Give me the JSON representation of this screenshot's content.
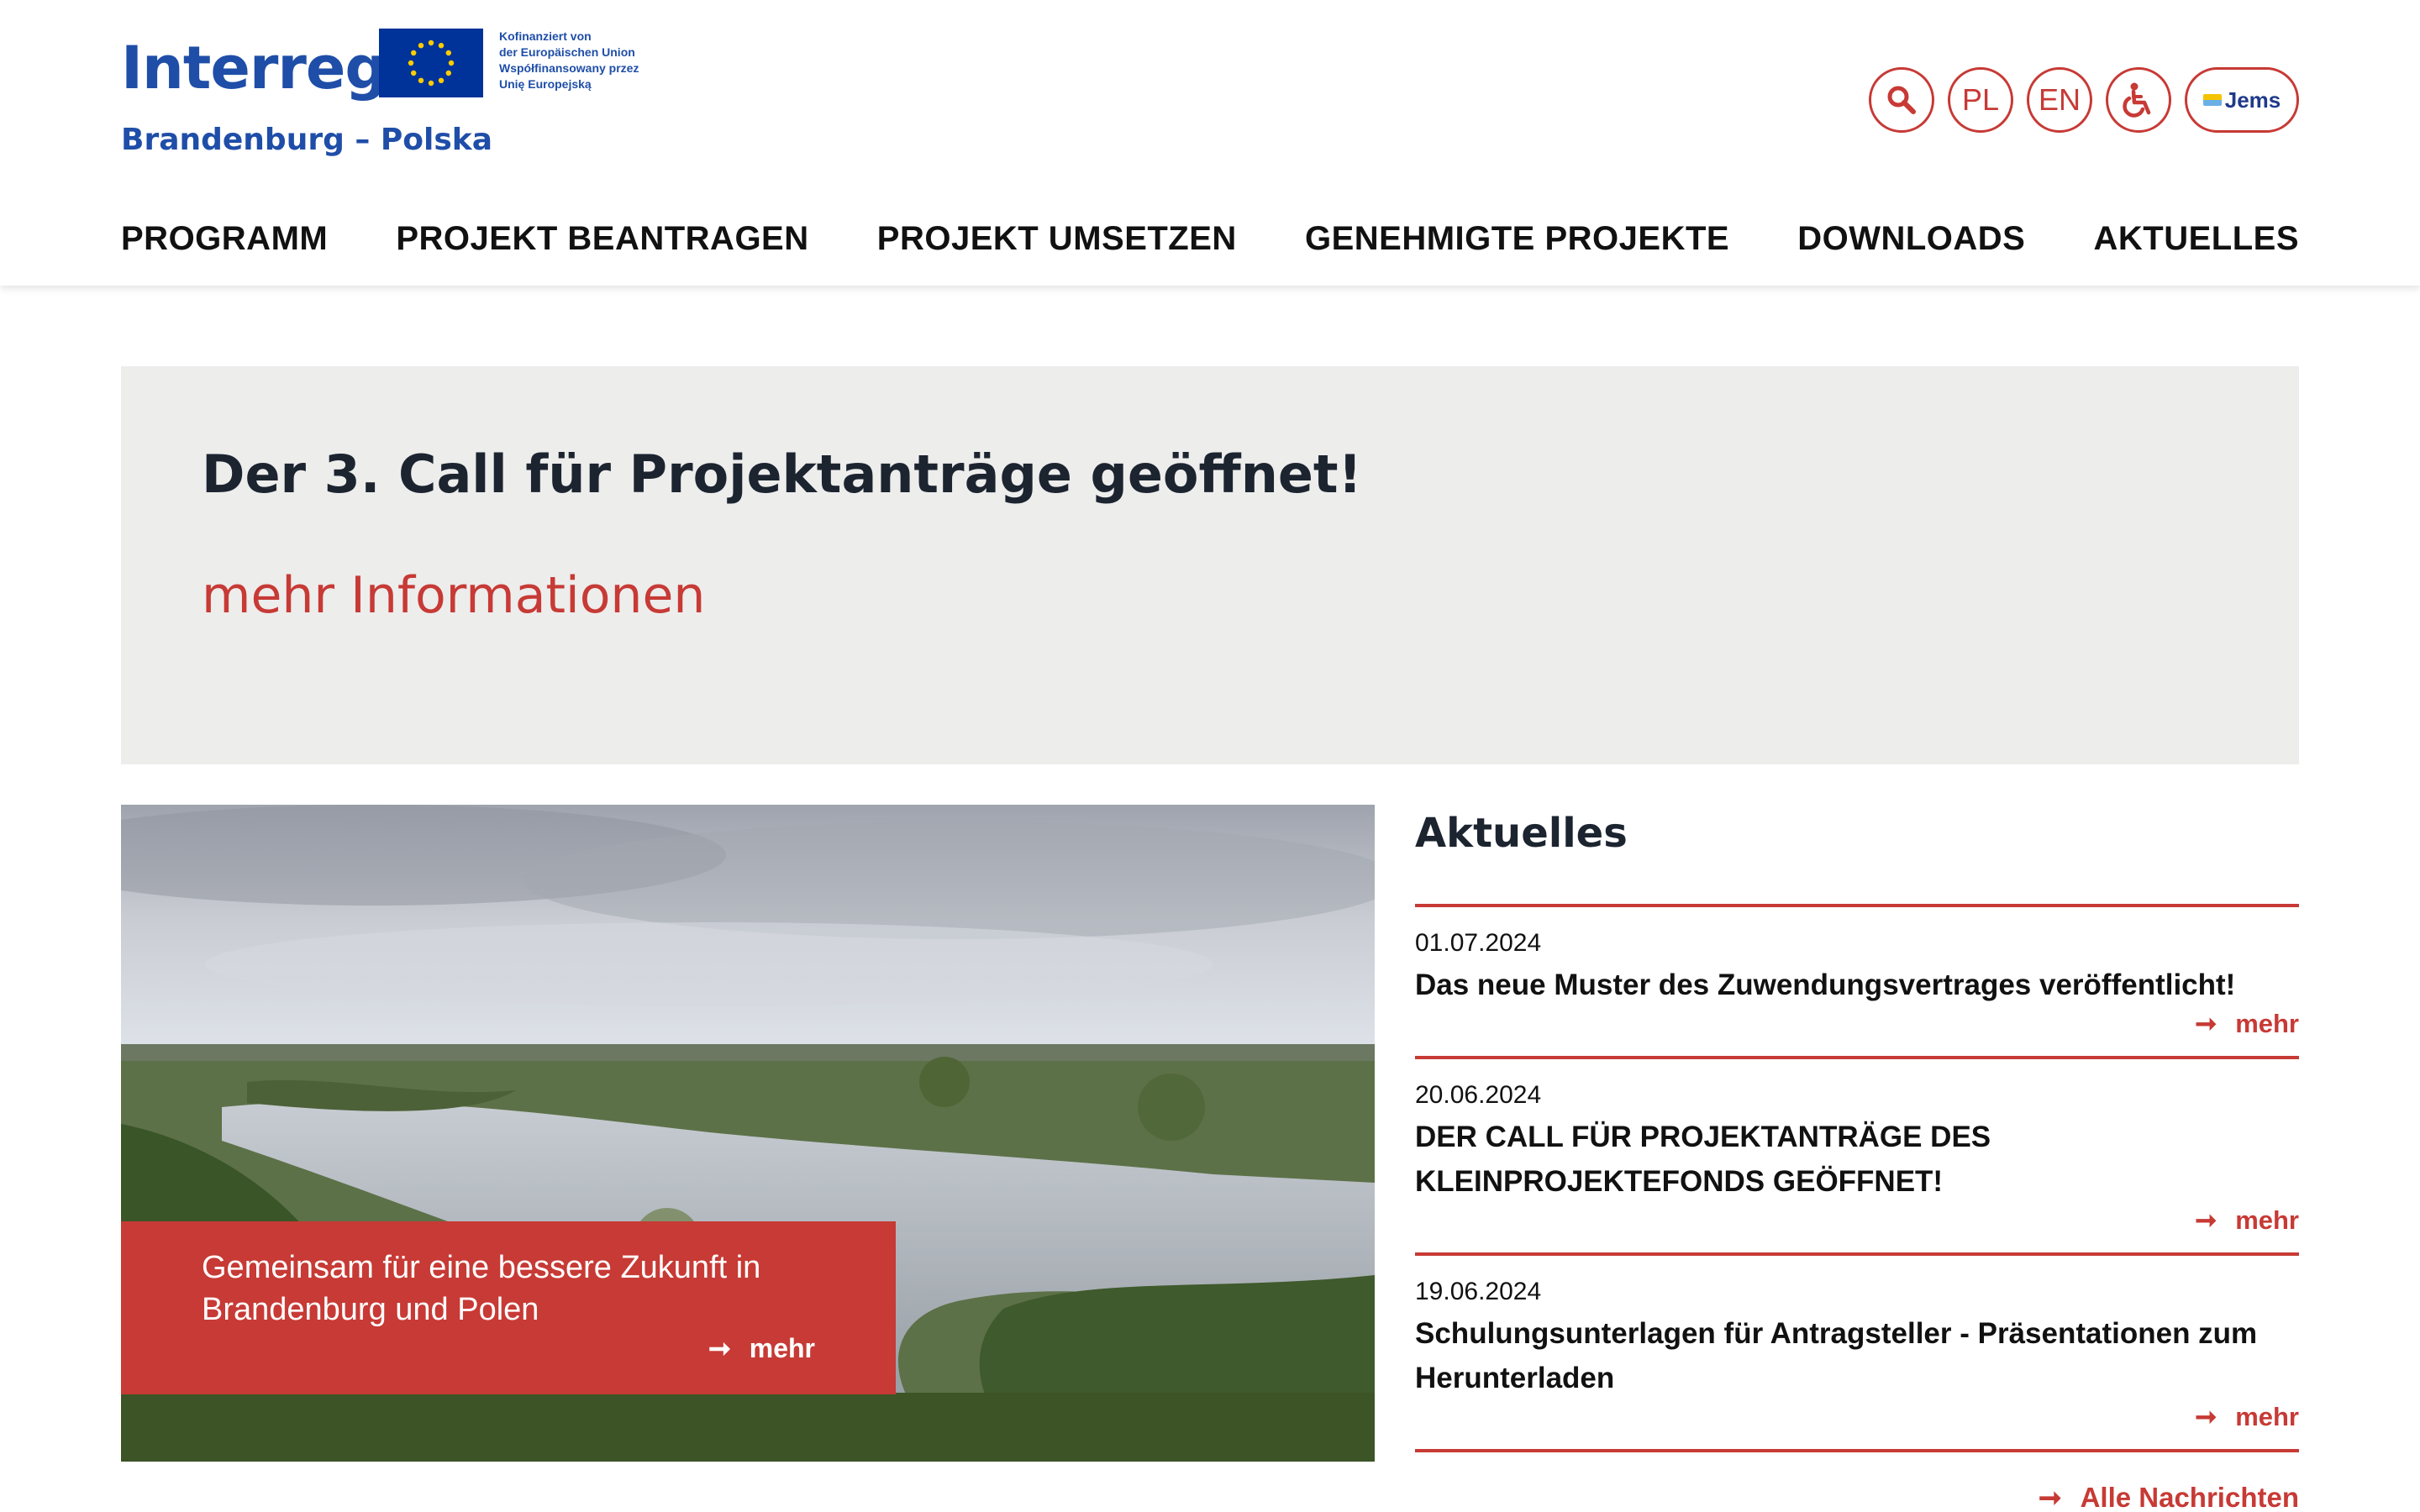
{
  "header": {
    "logo_word": "Interreg",
    "logo_region": "Brandenburg – Polska",
    "eu_lines": [
      "Kofinanziert von",
      "der Europäischen Union",
      "Współfinansowany przez",
      "Unię Europejską"
    ],
    "utility": {
      "search_icon": "search-icon",
      "lang_pl": "PL",
      "lang_en": "EN",
      "accessibility_icon": "wheelchair-icon",
      "jems_label": "Jems"
    }
  },
  "nav": [
    "PROGRAMM",
    "PROJEKT BEANTRAGEN",
    "PROJEKT UMSETZEN",
    "GENEHMIGTE PROJEKTE",
    "DOWNLOADS",
    "AKTUELLES"
  ],
  "banner": {
    "title": "Der 3. Call für Projektanträge geöffnet!",
    "link": "mehr Informationen"
  },
  "hero": {
    "text": "Gemeinsam für eine bessere Zukunft in Brandenburg und Polen",
    "more": "mehr"
  },
  "news": {
    "title": "Aktuelles",
    "items": [
      {
        "date": "01.07.2024",
        "headline": "Das neue Muster des Zuwendungsvertrages veröffentlicht!",
        "more": "mehr"
      },
      {
        "date": "20.06.2024",
        "headline": "DER CALL FÜR PROJEKTANTRÄGE DES KLEINPROJEKTEFONDS GEÖFFNET!",
        "more": "mehr"
      },
      {
        "date": "19.06.2024",
        "headline": "Schulungsunterlagen für Antragsteller - Präsentationen zum Herunterladen",
        "more": "mehr"
      }
    ],
    "all_news": "Alle Nachrichten"
  },
  "colors": {
    "accent": "#c73a35",
    "brand_blue": "#1f4ea8",
    "banner_bg": "#ededec"
  }
}
